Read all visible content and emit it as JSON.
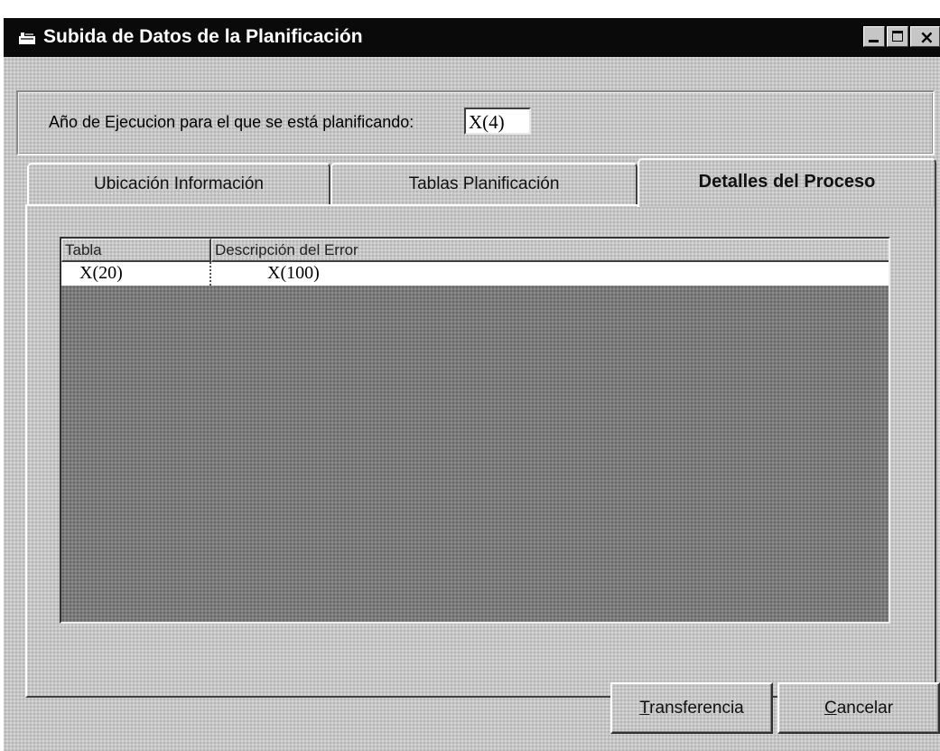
{
  "window": {
    "title": "Subida de Datos de la Planificación"
  },
  "year_section": {
    "label": "Año de Ejecucion para el que se está planificando:",
    "value": "X(4)"
  },
  "tabs": [
    {
      "label": "Ubicación Información",
      "selected": false
    },
    {
      "label": "Tablas Planificación",
      "selected": false
    },
    {
      "label": "Detalles del Proceso",
      "selected": true
    }
  ],
  "grid": {
    "columns": [
      "Tabla",
      "Descripción del Error"
    ],
    "rows": [
      [
        "X(20)",
        "X(100)"
      ]
    ]
  },
  "buttons": {
    "transferencia": {
      "mnemonic": "T",
      "rest": "ransferencia"
    },
    "cancelar": {
      "mnemonic": "C",
      "rest": "ancelar"
    }
  },
  "colors": {
    "titlebar": "#0a0a0a",
    "face": "#c6c6c6",
    "grid_background": "#7c7c7c"
  }
}
